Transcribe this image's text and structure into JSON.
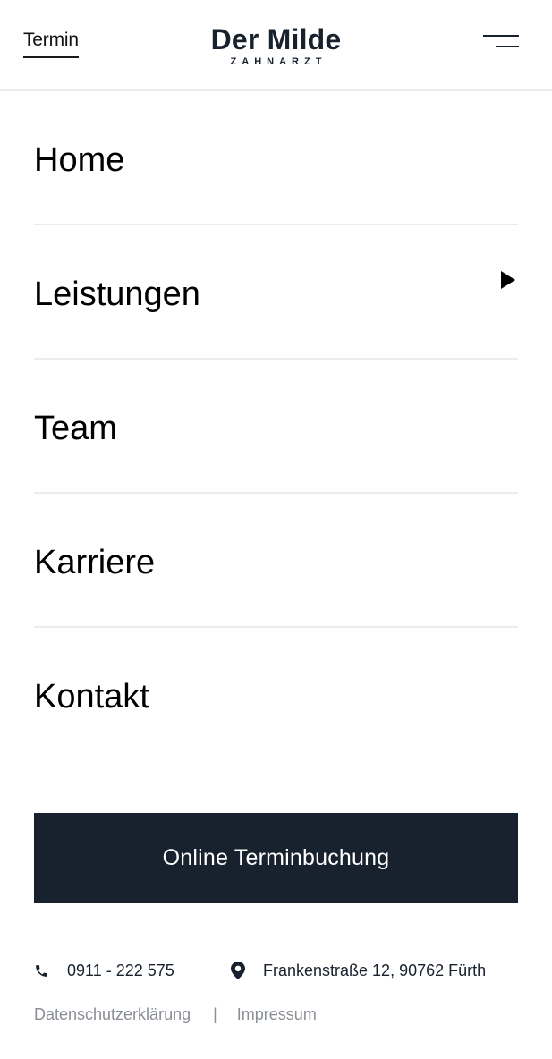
{
  "header": {
    "termin_label": "Termin",
    "logo_main": "Der Milde",
    "logo_sub": "ZAHNARZT",
    "menu_icon": "menu-lines-icon"
  },
  "nav": {
    "items": [
      {
        "label": "Home"
      },
      {
        "label": "Leistungen",
        "icon": "play-arrow-icon"
      },
      {
        "label": "Team"
      },
      {
        "label": "Karriere"
      },
      {
        "label": "Kontakt"
      }
    ]
  },
  "cta": {
    "label": "Online Terminbuchung"
  },
  "contact": {
    "phone": "0911 - 222 575",
    "phone_icon": "phone-icon",
    "address": "Frankenstraße 12, 90762 Fürth",
    "address_icon": "map-pin-icon"
  },
  "footer": {
    "privacy": "Datenschutzerklärung",
    "separator": "|",
    "imprint": "Impressum"
  },
  "colors": {
    "brand_dark": "#17222e",
    "divider": "#ececec",
    "muted_text": "#8a8f96"
  }
}
